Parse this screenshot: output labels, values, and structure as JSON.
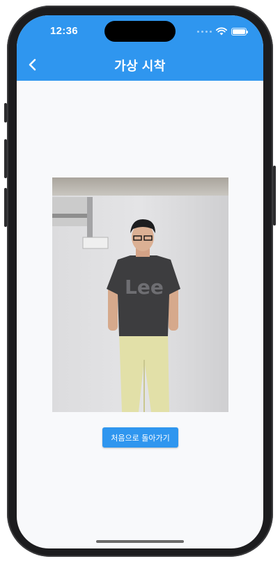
{
  "status_bar": {
    "time": "12:36",
    "icons": [
      "signal-dots-icon",
      "wifi-icon",
      "battery-icon"
    ]
  },
  "header": {
    "back_icon": "chevron-left-icon",
    "title": "가상 시착"
  },
  "main": {
    "image_icon": "person-photo",
    "home_button_label": "처음으로 돌아가기"
  },
  "colors": {
    "accent": "#2f96ef",
    "background": "#f8f9fb"
  }
}
